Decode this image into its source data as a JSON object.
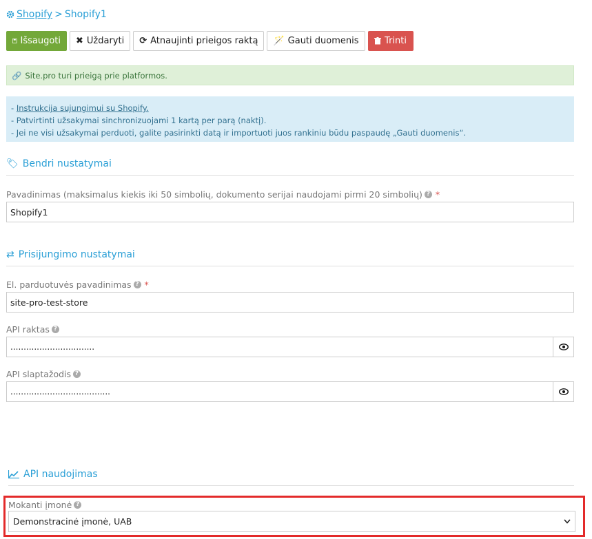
{
  "breadcrumb": {
    "root": "Shopify",
    "separator": ">",
    "current": "Shopify1"
  },
  "toolbar": {
    "save": "Išsaugoti",
    "close": "Uždaryti",
    "refresh_key": "Atnaujinti prieigos raktą",
    "get_data": "Gauti duomenis",
    "delete": "Trinti"
  },
  "alerts": {
    "success": "Site.pro turi prieigą prie platformos.",
    "info_link": "Instrukcija sujungimui su Shopify.",
    "info_line2": "- Patvirtinti užsakymai sinchronizuojami 1 kartą per parą (naktį).",
    "info_line3": "- Jei ne visi užsakymai perduoti, galite pasirinkti datą ir importuoti juos rankiniu būdu paspaudę „Gauti duomenis“."
  },
  "general": {
    "title": "Bendri nustatymai",
    "name_label": "Pavadinimas (maksimalus kiekis iki 50 simbolių, dokumento serijai naudojami pirmi 20 simbolių)",
    "name_value": "Shopify1"
  },
  "login": {
    "title": "Prisijungimo nustatymai",
    "store_label": "El. parduotuvės pavadinimas",
    "store_value": "site-pro-test-store",
    "api_key_label": "API raktas",
    "api_key_value": "................................",
    "api_password_label": "API slaptažodis",
    "api_password_value": "......................................"
  },
  "api_usage": {
    "title": "API naudojimas",
    "company_label": "Mokanti įmonė",
    "company_value": "Demonstracinė įmonė, UAB"
  },
  "colors": {
    "accent": "#2a9fd6",
    "success": "#73a839",
    "danger": "#d9534f",
    "highlight": "#e32a2a"
  }
}
